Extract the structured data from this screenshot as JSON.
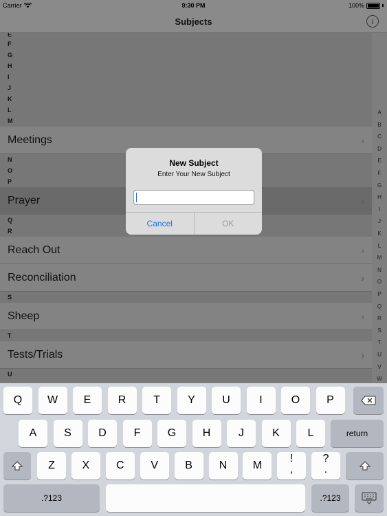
{
  "status_bar": {
    "carrier": "Carrier",
    "time": "9:30 PM",
    "battery": "100%"
  },
  "nav": {
    "title": "Subjects",
    "info_glyph": "i"
  },
  "table": {
    "top_letters": [
      "E",
      "F",
      "G",
      "H",
      "I",
      "J",
      "K",
      "L",
      "M"
    ],
    "rows": [
      {
        "kind": "cell",
        "label": "Meetings"
      },
      {
        "kind": "header",
        "label": "N"
      },
      {
        "kind": "header",
        "label": "O"
      },
      {
        "kind": "header",
        "label": "P"
      },
      {
        "kind": "cell",
        "label": "Prayer",
        "selected": true
      },
      {
        "kind": "header",
        "label": "Q"
      },
      {
        "kind": "header",
        "label": "R"
      },
      {
        "kind": "cell",
        "label": "Reach Out"
      },
      {
        "kind": "cell",
        "label": "Reconciliation"
      },
      {
        "kind": "header",
        "label": "S"
      },
      {
        "kind": "cell",
        "label": "Sheep"
      },
      {
        "kind": "header",
        "label": "T"
      },
      {
        "kind": "cell",
        "label": "Tests/Trials"
      },
      {
        "kind": "header",
        "label": "U"
      }
    ]
  },
  "index_letters": [
    "A",
    "B",
    "C",
    "D",
    "E",
    "F",
    "G",
    "H",
    "I",
    "J",
    "K",
    "L",
    "M",
    "N",
    "O",
    "P",
    "Q",
    "R",
    "S",
    "T",
    "U",
    "V",
    "W"
  ],
  "alert": {
    "title": "New Subject",
    "message": "Enter Your New Subject",
    "input_value": "",
    "cancel_label": "Cancel",
    "ok_label": "OK"
  },
  "keyboard": {
    "row1": [
      "Q",
      "W",
      "E",
      "R",
      "T",
      "Y",
      "U",
      "I",
      "O",
      "P"
    ],
    "row2": [
      "A",
      "S",
      "D",
      "F",
      "G",
      "H",
      "J",
      "K",
      "L"
    ],
    "return_label": "return",
    "row3": [
      "Z",
      "X",
      "C",
      "V",
      "B",
      "N",
      "M"
    ],
    "punct1_top": "!",
    "punct1_bottom": ",",
    "punct2_top": "?",
    "punct2_bottom": ".",
    "numbers_label": ".?123",
    "icons": {
      "backspace": "backspace-icon",
      "shift": "shift-icon",
      "hide_keyboard": "keyboard-dismiss-icon"
    }
  }
}
